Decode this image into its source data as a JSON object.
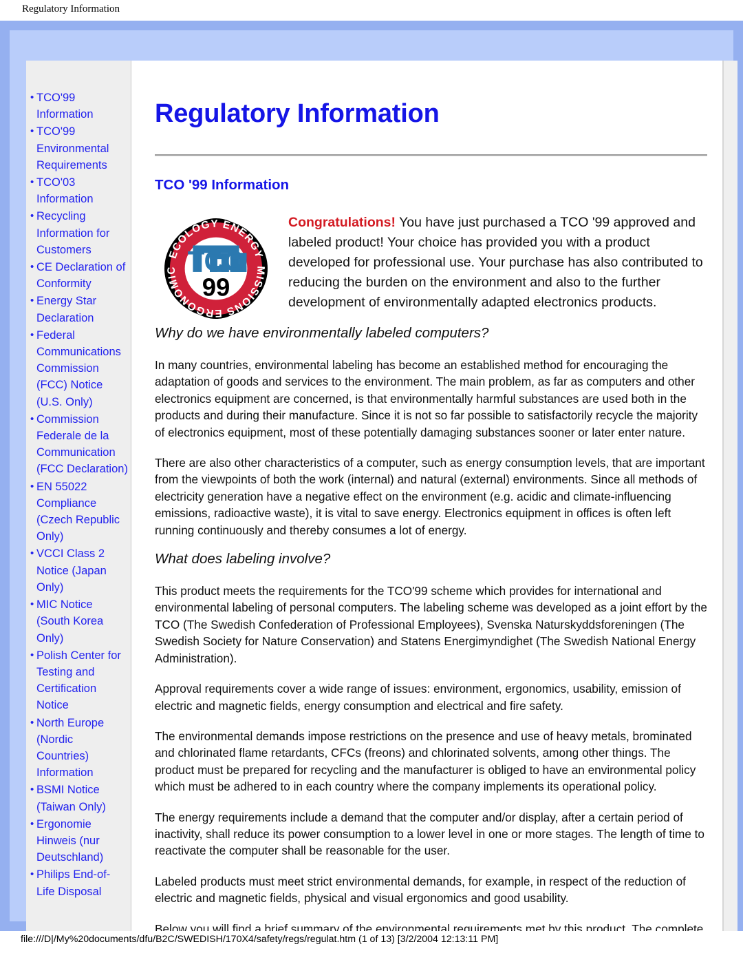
{
  "print_header": "Regulatory Information",
  "print_footer": "file:///D|/My%20documents/dfu/B2C/SWEDISH/170X4/safety/regs/regulat.htm (1 of 13) [3/2/2004 12:13:11 PM]",
  "colors": {
    "frame_blue": "#95b0f0",
    "frame_inner_blue": "#b9cdfa",
    "link_blue": "#2323ee",
    "heading_blue": "#1515e6",
    "congrats_red": "#d31b23",
    "sidebar_bg": "#eeeeee",
    "logo_red": "#d0213a",
    "logo_blue": "#2b79b0"
  },
  "sidebar": {
    "items": [
      {
        "label": "TCO'99 Information"
      },
      {
        "label": "TCO'99 Environmental Requirements"
      },
      {
        "label": "TCO'03 Information"
      },
      {
        "label": "Recycling Information for Customers"
      },
      {
        "label": "CE Declaration of Conformity"
      },
      {
        "label": "Energy Star Declaration"
      },
      {
        "label": "Federal Communications Commission (FCC) Notice (U.S. Only)"
      },
      {
        "label": "Commission Federale de la Communication (FCC Declaration)"
      },
      {
        "label": "EN 55022 Compliance (Czech Republic Only)"
      },
      {
        "label": "VCCI Class 2 Notice (Japan Only)"
      },
      {
        "label": "MIC Notice (South Korea Only)"
      },
      {
        "label": "Polish Center for Testing and Certification Notice"
      },
      {
        "label": "North Europe (Nordic Countries) Information"
      },
      {
        "label": "BSMI Notice (Taiwan Only)"
      },
      {
        "label": "Ergonomie Hinweis (nur Deutschland)"
      },
      {
        "label": "Philips End-of-Life Disposal"
      }
    ]
  },
  "main": {
    "title": "Regulatory Information",
    "section_title": "TCO '99 Information",
    "logo": {
      "name": "tco-99-certification-logo",
      "top_text": "ECOLOGY ENERGY",
      "bottom_text": "EMISSIONS ERGONOMICS",
      "brand": "TCO",
      "year": "99"
    },
    "intro_lead": "Congratulations!",
    "intro_body": " You have just purchased a TCO '99 approved and labeled product! Your choice has provided you with a product developed for professional use. Your purchase has also contributed to reducing the burden on the environment and also to the further development of environmentally adapted electronics products.",
    "subhead_1": "Why do we have environmentally labeled computers?",
    "para_1": "In many countries, environmental labeling has become an established method for encouraging the adaptation of goods and services to the environment. The main problem, as far as computers and other electronics equipment are concerned, is that environmentally harmful substances are used both in the products and during their manufacture. Since it is not so far possible to satisfactorily recycle the majority of electronics equipment, most of these potentially damaging substances sooner or later enter nature.",
    "para_2": "There are also other characteristics of a computer, such as energy consumption levels, that are important from the viewpoints of both the work (internal) and natural (external) environments. Since all methods of electricity generation have a negative effect on the environment (e.g. acidic and climate-influencing emissions, radioactive waste), it is vital to save energy. Electronics equipment in offices is often left running continuously and thereby consumes a lot of energy.",
    "subhead_2": "What does labeling involve?",
    "para_3": "This product meets the requirements for the TCO'99 scheme which provides for international and environmental labeling of personal computers. The labeling scheme was developed as a joint effort by the TCO (The Swedish Confederation of Professional Employees), Svenska Naturskyddsforeningen (The Swedish Society for Nature Conservation) and Statens Energimyndighet (The Swedish National Energy Administration).",
    "para_4": "Approval requirements cover a wide range of issues: environment, ergonomics, usability, emission of electric and magnetic fields, energy consumption and electrical and fire safety.",
    "para_5": "The environmental demands impose restrictions on the presence and use of heavy metals, brominated and chlorinated flame retardants, CFCs (freons) and chlorinated solvents, among other things. The product must be prepared for recycling and the manufacturer is obliged to have an environmental policy which must be adhered to in each country where the company implements its operational policy.",
    "para_6": "The energy requirements include a demand that the computer and/or display, after a certain period of inactivity, shall reduce its power consumption to a lower level in one or more stages. The length of time to reactivate the computer shall be reasonable for the user.",
    "para_7": "Labeled products must meet strict environmental demands, for example, in respect of the reduction of electric and magnetic fields, physical and visual ergonomics and good usability.",
    "para_8": "Below you will find a brief summary of the environmental requirements met by this product. The complete"
  }
}
